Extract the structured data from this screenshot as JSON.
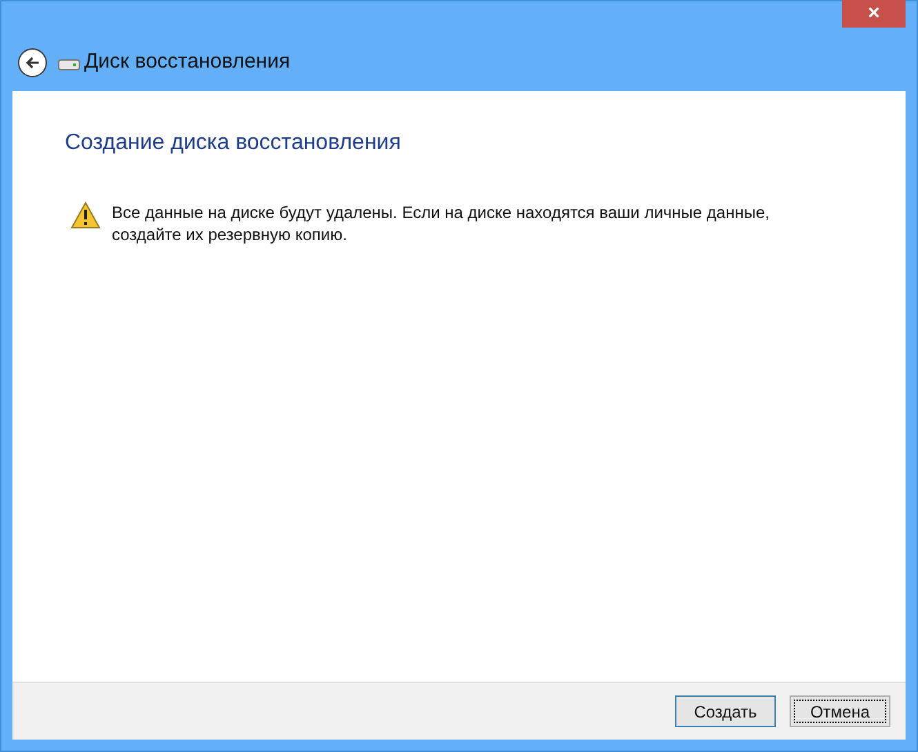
{
  "window": {
    "title": "Диск восстановления",
    "close": "×"
  },
  "heading": "Создание диска восстановления",
  "warning": "Все данные на диске будут удалены. Если на диске находятся ваши личные данные, создайте их резервную копию.",
  "buttons": [
    {
      "label": "Создать",
      "default": true,
      "focused": false
    },
    {
      "label": "Отмена",
      "default": false,
      "focused": true
    }
  ]
}
